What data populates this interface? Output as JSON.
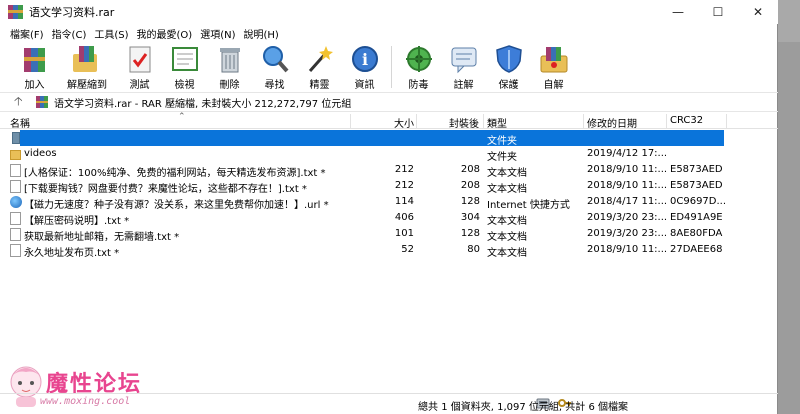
{
  "window": {
    "title": "语文学习资料.rar",
    "controls": {
      "minimize": "—",
      "maximize": "☐",
      "close": "✕"
    }
  },
  "menu": [
    "檔案(F)",
    "指令(C)",
    "工具(S)",
    "我的最愛(O)",
    "選項(N)",
    "說明(H)"
  ],
  "toolbar": [
    {
      "label": "加入",
      "icon": "add-archive-icon"
    },
    {
      "label": "解壓縮到",
      "icon": "extract-to-icon"
    },
    {
      "label": "測試",
      "icon": "test-icon"
    },
    {
      "label": "檢視",
      "icon": "view-icon"
    },
    {
      "label": "刪除",
      "icon": "delete-icon"
    },
    {
      "label": "尋找",
      "icon": "find-icon"
    },
    {
      "label": "精靈",
      "icon": "wizard-icon"
    },
    {
      "label": "資訊",
      "icon": "info-icon"
    },
    {
      "label": "防毒",
      "icon": "virus-scan-icon"
    },
    {
      "label": "註解",
      "icon": "comment-icon"
    },
    {
      "label": "保護",
      "icon": "protect-icon"
    },
    {
      "label": "自解",
      "icon": "sfx-icon"
    }
  ],
  "address": {
    "text": "语文学习资料.rar - RAR 壓縮檔, 未封裝大小 212,272,797 位元組"
  },
  "columns": {
    "name": "名稱",
    "size": "大小",
    "packed": "封裝後",
    "type": "類型",
    "modified": "修改的日期",
    "crc": "CRC32"
  },
  "files": [
    {
      "name": "",
      "size": "",
      "packed": "",
      "type": "文件夹",
      "modified": "",
      "crc": "",
      "kind": "parent",
      "selected": true
    },
    {
      "name": "videos",
      "size": "",
      "packed": "",
      "type": "文件夹",
      "modified": "2019/4/12 17:...",
      "crc": "",
      "kind": "folder"
    },
    {
      "name": "[人格保证：100%纯净、免费的福利网站，每天精选发布资源].txt *",
      "size": "212",
      "packed": "208",
      "type": "文本文档",
      "modified": "2018/9/10 11:...",
      "crc": "E5873AED",
      "kind": "doc"
    },
    {
      "name": "[下载要掏钱？网盘要付费？来魔性论坛，这些都不存在！].txt *",
      "size": "212",
      "packed": "208",
      "type": "文本文档",
      "modified": "2018/9/10 11:...",
      "crc": "E5873AED",
      "kind": "doc"
    },
    {
      "name": "【磁力无速度？种子没有源？没关系，来这里免费帮你加速！】.url *",
      "size": "114",
      "packed": "128",
      "type": "Internet 快捷方式",
      "modified": "2018/4/17 11:...",
      "crc": "0C9697D...",
      "kind": "url"
    },
    {
      "name": "【解压密码说明】.txt *",
      "size": "406",
      "packed": "304",
      "type": "文本文档",
      "modified": "2019/3/20 23:...",
      "crc": "ED491A9E",
      "kind": "doc"
    },
    {
      "name": "获取最新地址邮箱，无需翻墙.txt *",
      "size": "101",
      "packed": "128",
      "type": "文本文档",
      "modified": "2019/3/20 23:...",
      "crc": "8AE80FDA",
      "kind": "doc"
    },
    {
      "name": "永久地址发布页.txt *",
      "size": "52",
      "packed": "80",
      "type": "文本文档",
      "modified": "2018/9/10 11:...",
      "crc": "27DAEE68",
      "kind": "doc"
    }
  ],
  "status": {
    "text": "總共 1 個資料夾, 1,097 位元組, 共計 6 個檔案"
  },
  "watermark": {
    "title": "魔性论坛",
    "url": "www.moxing.cool"
  },
  "colors": {
    "selection": "#0a74da",
    "watermark": "#e8458f"
  }
}
